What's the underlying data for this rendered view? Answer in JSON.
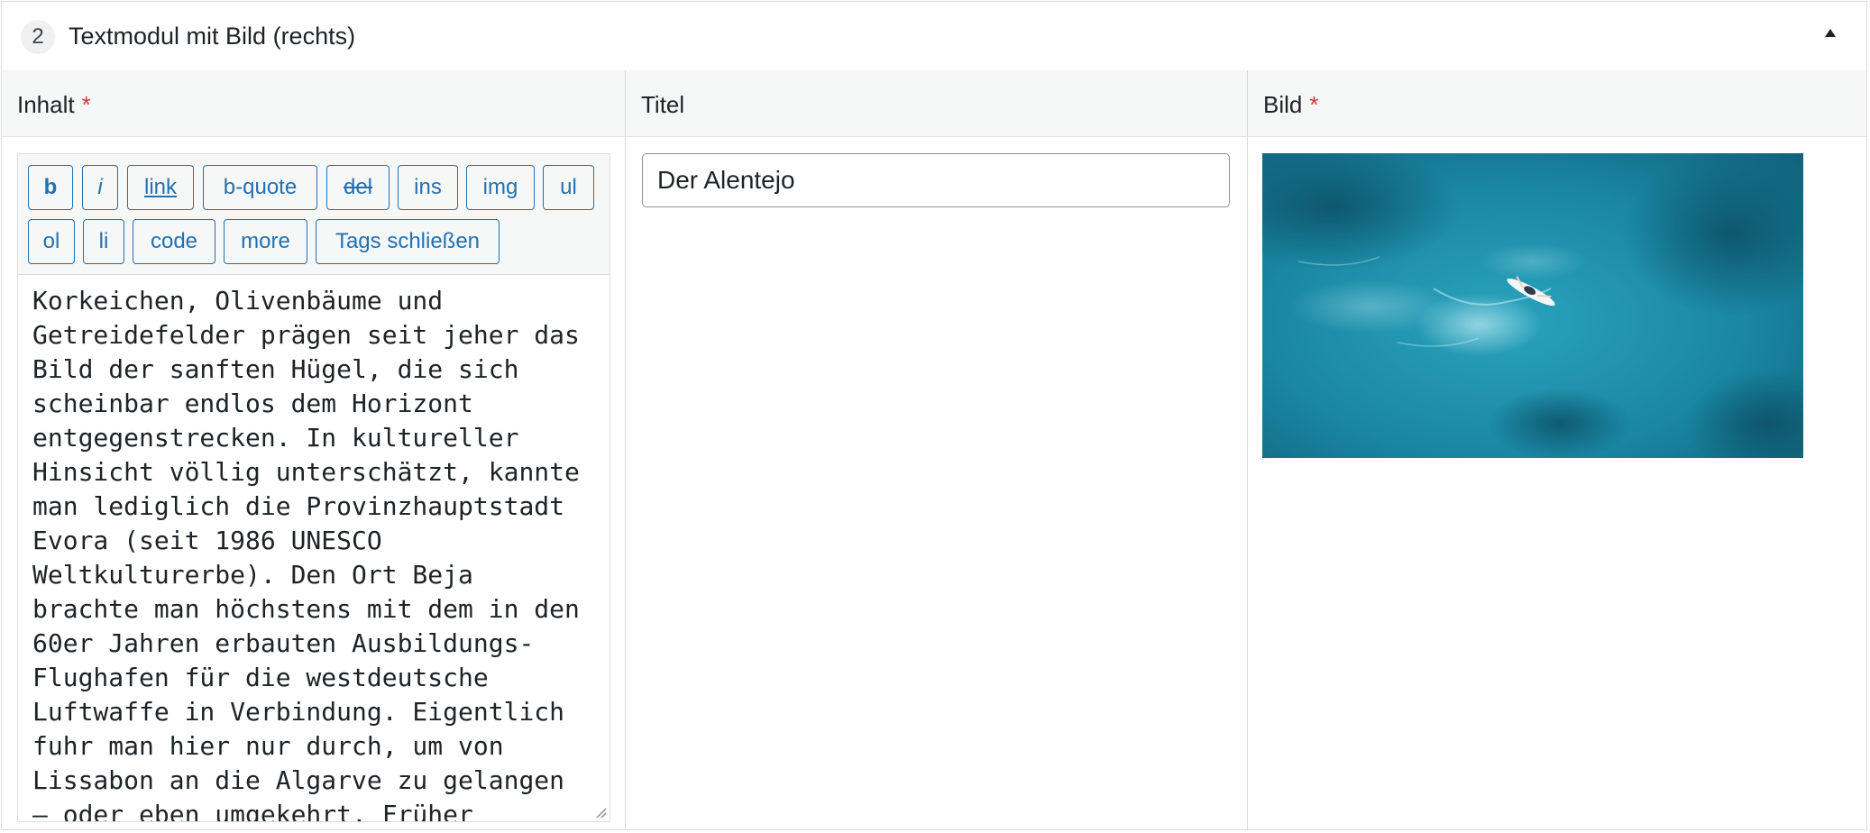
{
  "module": {
    "order": "2",
    "title": "Textmodul mit Bild (rechts)"
  },
  "columns": {
    "content_label": "Inhalt",
    "title_label": "Titel",
    "image_label": "Bild",
    "required_mark": "*"
  },
  "quicktags": [
    {
      "label": "b"
    },
    {
      "label": "i"
    },
    {
      "label": "link"
    },
    {
      "label": "b-quote"
    },
    {
      "label": "del"
    },
    {
      "label": "ins"
    },
    {
      "label": "img"
    },
    {
      "label": "ul"
    },
    {
      "label": "ol"
    },
    {
      "label": "li"
    },
    {
      "label": "code"
    },
    {
      "label": "more"
    },
    {
      "label": "Tags schließen"
    }
  ],
  "content_text": "Korkeichen, Olivenbäume und\nGetreidefelder prägen seit jeher das\nBild der sanften Hügel, die sich\nscheinbar endlos dem Horizont\nentgegenstrecken. In kultureller\nHinsicht völlig unterschätzt, kannte\nman lediglich die Provinzhauptstadt\nEvora (seit 1986 UNESCO\nWeltkulturerbe). Den Ort Beja\nbrachte man höchstens mit dem in den\n60er Jahren erbauten Ausbildungs-\nFlughafen für die westdeutsche\nLuftwaffe in Verbindung. Eigentlich\nfuhr man hier nur durch, um von\nLissabon an die Algarve zu gelangen\n– oder eben umgekehrt. Früher",
  "title_value": "Der Alentejo",
  "colors": {
    "accent": "#2271b1",
    "required": "#d63638",
    "border": "#dcdcde",
    "header_bg": "#f6f7f7"
  }
}
